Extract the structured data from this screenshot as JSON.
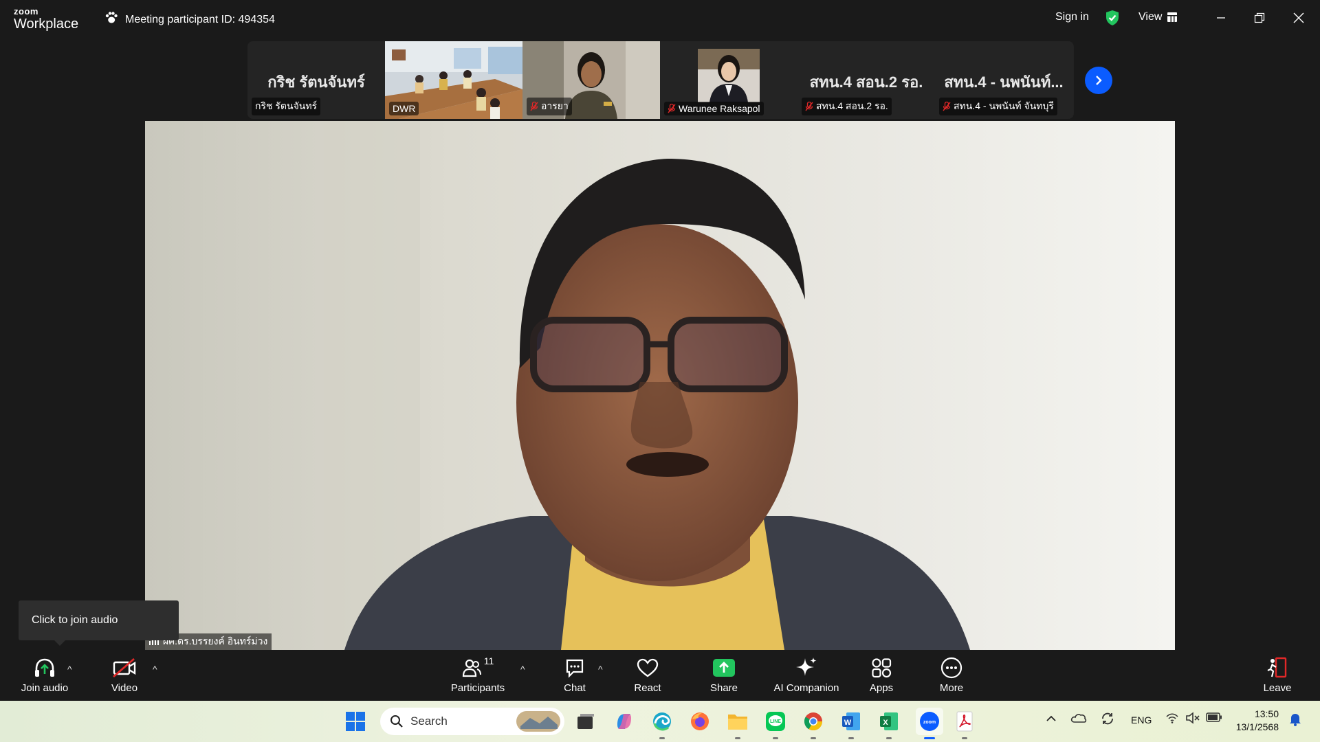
{
  "titlebar": {
    "brand_top": "zoom",
    "brand_bottom": "Workplace",
    "meeting_label": "Meeting participant ID: 494354",
    "sign_in": "Sign in",
    "view": "View"
  },
  "gallery": {
    "tiles": [
      {
        "big_name": "กริช รัตนจันทร์",
        "label": "กริช รัตนจันทร์",
        "muted": false
      },
      {
        "big_name": "",
        "label": "DWR",
        "muted": false
      },
      {
        "big_name": "",
        "label": "อารยา",
        "muted": true
      },
      {
        "big_name": "",
        "label": "Warunee Raksapol",
        "muted": true
      },
      {
        "big_name": "สทน.4 สอน.2 รอ.",
        "label": "สทน.4 สอน.2 รอ.",
        "muted": true
      },
      {
        "big_name": "สทน.4 - นพนันท์...",
        "label": "สทน.4 - นพนันท์ จันทบุรี",
        "muted": true
      }
    ]
  },
  "main_video": {
    "speaker_label": "ผศ.ดร.บรรยงค์ อินทร์ม่วง"
  },
  "tooltip": "Click to join audio",
  "toolbar": {
    "join_audio": "Join audio",
    "video": "Video",
    "participants": "Participants",
    "participants_count": "11",
    "chat": "Chat",
    "react": "React",
    "share": "Share",
    "ai_companion": "AI Companion",
    "apps": "Apps",
    "more": "More",
    "leave": "Leave"
  },
  "taskbar": {
    "search_placeholder": "Search",
    "lang": "ENG",
    "time": "13:50",
    "date": "13/1/2568"
  },
  "colors": {
    "zoom_blue": "#0b5cff",
    "share_green": "#22c55e",
    "leave_red": "#e02828"
  }
}
